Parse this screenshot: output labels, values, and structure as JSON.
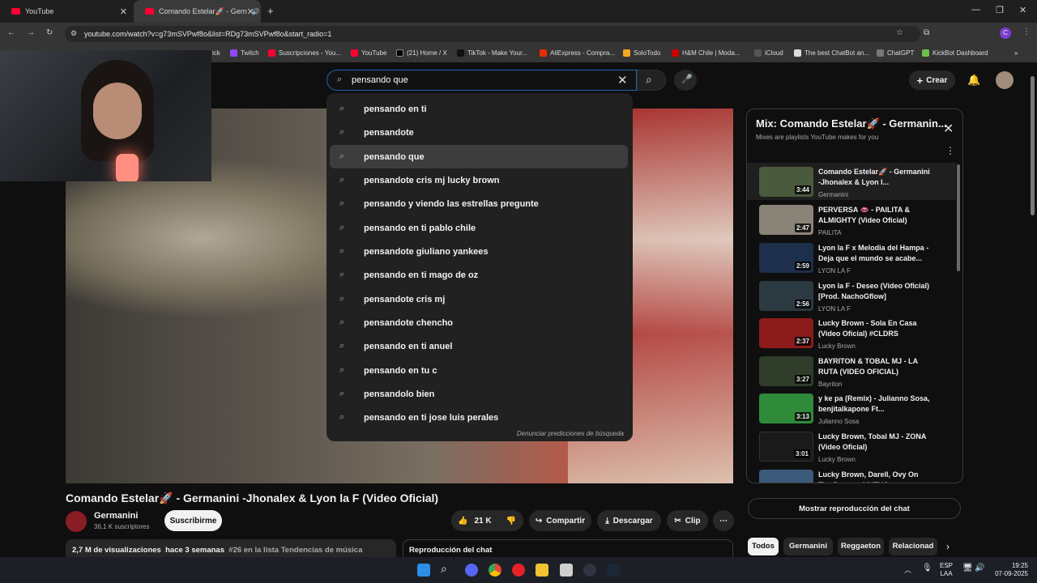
{
  "browser": {
    "tabs": [
      {
        "title": "YouTube"
      },
      {
        "title": "Comando Estelar🚀 - Gern"
      }
    ],
    "url": "youtube.com/watch?v=g73mSVPwf8o&list=RDg73mSVPwf8o&start_radio=1",
    "bookmarks": [
      "ick",
      "Twitch",
      "Suscripciones - You...",
      "YouTube",
      "(21) Home / X",
      "TikTok - Make Your...",
      "AliExpress - Compra...",
      "SoloTodo",
      "H&M Chile | Moda...",
      "iCloud",
      "The best ChatBot an...",
      "ChatGPT",
      "KickBot Dashboard"
    ]
  },
  "search": {
    "value": "pensando que",
    "suggestions": [
      "pensando en ti",
      "pensandote",
      "pensando que",
      "pensandote cris mj lucky brown",
      "pensando y viendo las estrellas pregunte",
      "pensando en ti pablo chile",
      "pensandote giuliano yankees",
      "pensando en ti mago de oz",
      "pensandote cris mj",
      "pensandote chencho",
      "pensando en ti anuel",
      "pensando en tu c",
      "pensandolo bien",
      "pensando en ti jose luis perales"
    ],
    "report": "Denunciar predicciones de búsqueda"
  },
  "header": {
    "create": "Crear"
  },
  "video": {
    "title": "Comando Estelar🚀 - Germanini -Jhonalex & Lyon la F (Video Oficial)",
    "channel": "Germanini",
    "subscribers": "36,1 K suscriptores",
    "subscribe": "Suscribirme",
    "likes": "21 K",
    "share": "Compartir",
    "download": "Descargar",
    "clip": "Clip",
    "views": "2,7 M de visualizaciones",
    "age": "hace 3 semanas",
    "trending": "#26 en la lista Tendencias de música",
    "chat_replay": "Reproducción del chat"
  },
  "playlist": {
    "title": "Mix: Comando Estelar🚀 - Germanin...",
    "subtitle": "Mixes are playlists YouTube makes for you",
    "items": [
      {
        "title": "Comando Estelar🚀 - Germanini -Jhonalex & Lyon l...",
        "channel": "Germanini",
        "duration": "3:44",
        "color": "#4a5a3c"
      },
      {
        "title": "PERVERSA 👄 - PAILITA & ALMIGHTY (Video Oficial)",
        "channel": "PAILITA",
        "duration": "2:47",
        "color": "#8a8478"
      },
      {
        "title": "Lyon la F x Melodia del Hampa - Deja que el mundo se acabe...",
        "channel": "LYON LA F",
        "duration": "2:59",
        "color": "#1d2f4a"
      },
      {
        "title": "Lyon la F - Deseo (Video Oficial) [Prod. NachoGflow]",
        "channel": "LYON LA F",
        "duration": "2:56",
        "color": "#2b3a40"
      },
      {
        "title": "Lucky Brown - Sola En Casa (Video Oficial) #CLDRS",
        "channel": "Lucky Brown",
        "duration": "2:37",
        "color": "#8c1c1c"
      },
      {
        "title": "BAYRITON & TOBAL MJ - LA RUTA (VIDEO OFICIAL)",
        "channel": "Bayriton",
        "duration": "3:27",
        "color": "#2f3d2a"
      },
      {
        "title": "y ke pa (Remix) - Julianno Sosa, benjitalkapone Ft...",
        "channel": "Julianno Sosa",
        "duration": "3:13",
        "color": "#2f8a3a"
      },
      {
        "title": "Lucky Brown, Tobal MJ - ZONA (Video Oficial)",
        "channel": "Lucky Brown",
        "duration": "3:01",
        "color": "#1a1a1a"
      },
      {
        "title": "Lucky Brown, Darell, Ovy On The Drums - NUEVO...",
        "channel": "",
        "duration": "",
        "color": "#3b5a7a"
      }
    ],
    "chat_button": "Mostrar reproducción del chat",
    "chips": [
      "Todos",
      "Germanini",
      "Reggaeton",
      "Relacionad"
    ]
  },
  "taskbar": {
    "lang1": "ESP",
    "lang2": "LAA",
    "time": "19:25",
    "date": "07-09-2025"
  }
}
